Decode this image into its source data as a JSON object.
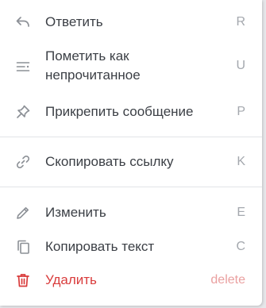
{
  "menu": {
    "items": [
      {
        "label": "Ответить",
        "shortcut": "R",
        "icon": "reply-icon"
      },
      {
        "label": "Пометить как непрочитанное",
        "shortcut": "U",
        "icon": "mark-unread-icon"
      },
      {
        "label": "Прикрепить сообщение",
        "shortcut": "P",
        "icon": "pin-icon"
      },
      {
        "label": "Скопировать ссылку",
        "shortcut": "K",
        "icon": "link-icon"
      },
      {
        "label": "Изменить",
        "shortcut": "E",
        "icon": "pencil-icon"
      },
      {
        "label": "Копировать текст",
        "shortcut": "C",
        "icon": "copy-icon"
      },
      {
        "label": "Удалить",
        "shortcut": "delete",
        "icon": "trash-icon"
      }
    ]
  },
  "colors": {
    "text": "#3b3f45",
    "shortcut": "#a4a8ae",
    "danger": "#d93c3c",
    "danger_shortcut": "#eaa0a0",
    "divider": "#e2e4e7",
    "icon": "#8c9096"
  }
}
